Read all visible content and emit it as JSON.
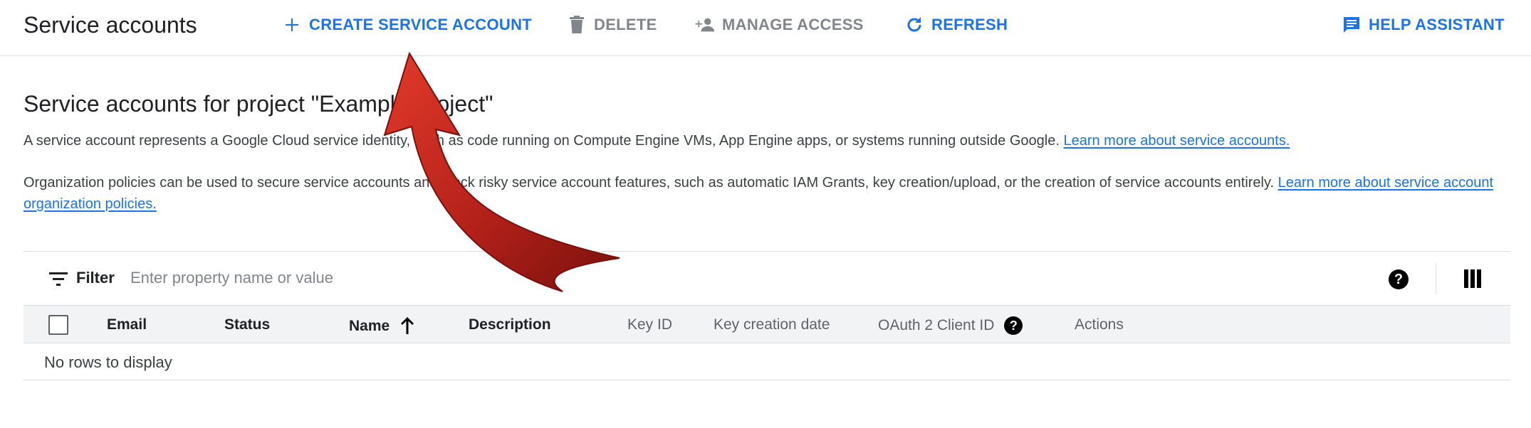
{
  "header": {
    "title": "Service accounts",
    "actions": {
      "create": "CREATE SERVICE ACCOUNT",
      "delete": "DELETE",
      "manage_access": "MANAGE ACCESS",
      "refresh": "REFRESH",
      "help": "HELP ASSISTANT"
    }
  },
  "main": {
    "heading": "Service accounts for project \"Example Project\"",
    "description": "A service account represents a Google Cloud service identity, such as code running on Compute Engine VMs, App Engine apps, or systems running outside Google.",
    "description_link": "Learn more about service accounts.",
    "policy_text": "Organization policies can be used to secure service accounts and block risky service account features, such as automatic IAM Grants, key creation/upload, or the creation of service accounts entirely.",
    "policy_link": "Learn more about service account organization policies."
  },
  "filter": {
    "label": "Filter",
    "placeholder": "Enter property name or value"
  },
  "table": {
    "columns": {
      "email": "Email",
      "status": "Status",
      "name": "Name",
      "description": "Description",
      "key_id": "Key ID",
      "key_creation_date": "Key creation date",
      "oauth_client_id": "OAuth 2 Client ID",
      "actions": "Actions"
    },
    "sort_column": "Name",
    "sort_direction": "ascending",
    "empty_message": "No rows to display"
  },
  "icons": {
    "create": "add-icon",
    "delete": "trash-icon",
    "manage_access": "person-add-icon",
    "refresh": "refresh-icon",
    "help": "feedback-icon",
    "filter": "filter-icon",
    "help_circle": "help-circle-icon",
    "columns": "column-display-icon",
    "annotation": "curved-arrow"
  },
  "colors": {
    "accent": "#1a73e8",
    "disabled": "#80868b",
    "annotation_arrow": "#b3211a"
  }
}
